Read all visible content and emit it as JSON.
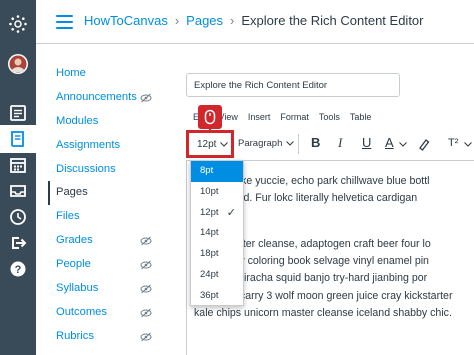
{
  "colors": {
    "nav_bg": "#394b58",
    "accent": "#008ee2",
    "highlight": "#d1262b"
  },
  "global_nav": {
    "items": [
      {
        "icon": "canvas-logo-icon"
      },
      {
        "icon": "user-avatar-icon"
      },
      {
        "icon": "dashboard-icon"
      },
      {
        "icon": "courses-book-icon",
        "active": true
      },
      {
        "icon": "calendar-icon"
      },
      {
        "icon": "inbox-icon"
      },
      {
        "icon": "history-clock-icon"
      },
      {
        "icon": "commons-arrow-icon"
      },
      {
        "icon": "help-icon"
      }
    ]
  },
  "breadcrumbs": [
    {
      "label": "HowToCanvas"
    },
    {
      "label": "Pages"
    },
    {
      "label": "Explore the Rich Content Editor"
    }
  ],
  "course_nav": {
    "items": [
      {
        "label": "Home",
        "hidden_icon": false
      },
      {
        "label": "Announcements",
        "hidden_icon": true
      },
      {
        "label": "Modules",
        "hidden_icon": false
      },
      {
        "label": "Assignments",
        "hidden_icon": false
      },
      {
        "label": "Discussions",
        "hidden_icon": false
      },
      {
        "label": "Pages",
        "hidden_icon": false,
        "active": true
      },
      {
        "label": "Files",
        "hidden_icon": false
      },
      {
        "label": "Grades",
        "hidden_icon": true
      },
      {
        "label": "People",
        "hidden_icon": true
      },
      {
        "label": "Syllabus",
        "hidden_icon": true
      },
      {
        "label": "Outcomes",
        "hidden_icon": true
      },
      {
        "label": "Rubrics",
        "hidden_icon": true
      }
    ]
  },
  "page_title_value": "Explore the Rich Content Editor",
  "menubar": [
    "Edit",
    "View",
    "Insert",
    "Format",
    "Tools",
    "Table"
  ],
  "toolbar": {
    "font_size": "12pt",
    "block_format": "Paragraph",
    "bold": "B",
    "italic": "I",
    "underline": "U",
    "text_color": "A",
    "superscript": "T²"
  },
  "font_size_menu": {
    "options": [
      "8pt",
      "10pt",
      "12pt",
      "14pt",
      "18pt",
      "24pt",
      "36pt"
    ],
    "hovered": "8pt",
    "selected": "12pt"
  },
  "editor_lines": [
    "artorial poke yuccie, echo park chillwave blue bottl",
    "cloud bread. Fur lokc literally helvetica cardigan",
    "n",
    "prism master cleanse, adaptogen craft beer four lo",
    "essay cray coloring book selvage vinyl enamel pin",
    "portland sriracha squid banjo try-hard jianbing por",
    "everyday carry 3 wolf moon green juice cray kickstarter",
    "kale chips unicorn master cleanse iceland shabby chic."
  ]
}
